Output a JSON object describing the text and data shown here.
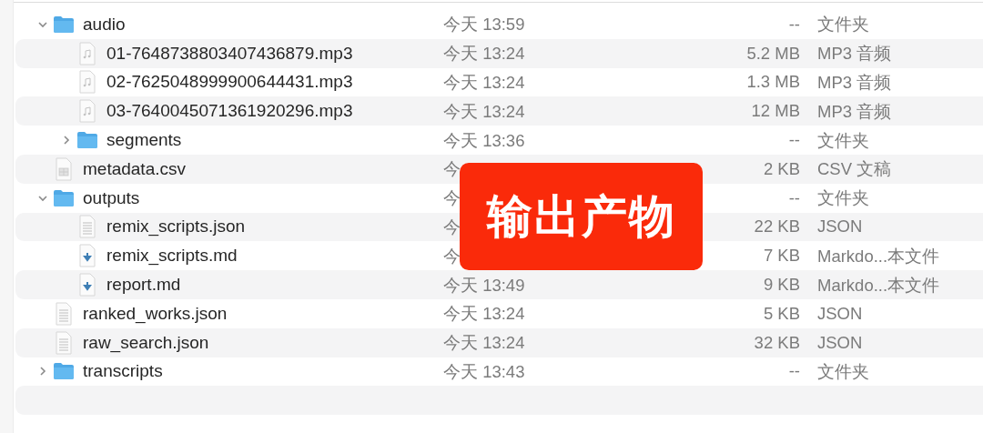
{
  "files": [
    {
      "name": "audio",
      "kind": "folder",
      "expanded": true,
      "date": "今天 13:59",
      "size": "--",
      "file_type": "文件夹",
      "children": [
        {
          "name": "01-7648738803407436879.mp3",
          "kind": "audio",
          "date": "今天 13:24",
          "size": "5.2 MB",
          "file_type": "MP3 音频"
        },
        {
          "name": "02-7625048999900644431.mp3",
          "kind": "audio",
          "date": "今天 13:24",
          "size": "1.3 MB",
          "file_type": "MP3 音频"
        },
        {
          "name": "03-7640045071361920296.mp3",
          "kind": "audio",
          "date": "今天 13:24",
          "size": "12 MB",
          "file_type": "MP3 音频"
        },
        {
          "name": "segments",
          "kind": "folder",
          "expanded": false,
          "date": "今天 13:36",
          "size": "--",
          "file_type": "文件夹"
        }
      ]
    },
    {
      "name": "metadata.csv",
      "kind": "spreadsheet",
      "date": "今",
      "size": "2 KB",
      "file_type": "CSV 文稿"
    },
    {
      "name": "outputs",
      "kind": "folder",
      "expanded": true,
      "date": "今",
      "size": "--",
      "file_type": "文件夹",
      "children": [
        {
          "name": "remix_scripts.json",
          "kind": "text",
          "date": "今",
          "size": "22 KB",
          "file_type": "JSON"
        },
        {
          "name": "remix_scripts.md",
          "kind": "markdown",
          "date": "今",
          "size": "7 KB",
          "file_type": "Markdo...本文件"
        },
        {
          "name": "report.md",
          "kind": "markdown",
          "date": "今天 13:49",
          "size": "9 KB",
          "file_type": "Markdo...本文件"
        }
      ]
    },
    {
      "name": "ranked_works.json",
      "kind": "text",
      "date": "今天 13:24",
      "size": "5 KB",
      "file_type": "JSON"
    },
    {
      "name": "raw_search.json",
      "kind": "text",
      "date": "今天 13:24",
      "size": "32 KB",
      "file_type": "JSON"
    },
    {
      "name": "transcripts",
      "kind": "folder",
      "expanded": false,
      "date": "今天 13:43",
      "size": "--",
      "file_type": "文件夹"
    }
  ],
  "overlay_label": "输出产物"
}
